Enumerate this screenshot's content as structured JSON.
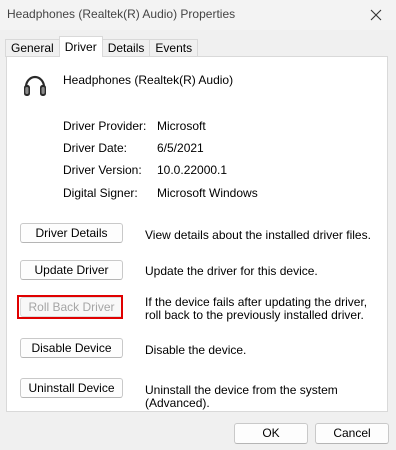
{
  "window": {
    "title": "Headphones (Realtek(R) Audio) Properties",
    "close_icon": "close-icon"
  },
  "tabs": [
    {
      "label": "General",
      "active": false
    },
    {
      "label": "Driver",
      "active": true
    },
    {
      "label": "Details",
      "active": false
    },
    {
      "label": "Events",
      "active": false
    }
  ],
  "device": {
    "icon": "headphones-icon",
    "name": "Headphones (Realtek(R) Audio)"
  },
  "driver_info": [
    {
      "label": "Driver Provider:",
      "value": "Microsoft"
    },
    {
      "label": "Driver Date:",
      "value": "6/5/2021"
    },
    {
      "label": "Driver Version:",
      "value": "10.0.22000.1"
    },
    {
      "label": "Digital Signer:",
      "value": "Microsoft Windows"
    }
  ],
  "actions": [
    {
      "label": "Driver Details",
      "description": "View details about the installed driver files.",
      "enabled": true
    },
    {
      "label": "Update Driver",
      "description": "Update the driver for this device.",
      "enabled": true
    },
    {
      "label": "Roll Back Driver",
      "description": "If the device fails after updating the driver, roll back to the previously installed driver.",
      "enabled": false,
      "highlight_color": "#e00000"
    },
    {
      "label": "Disable Device",
      "description": "Disable the device.",
      "enabled": true
    },
    {
      "label": "Uninstall Device",
      "description": "Uninstall the device from the system (Advanced).",
      "enabled": true
    }
  ],
  "footer": {
    "ok_label": "OK",
    "cancel_label": "Cancel"
  }
}
